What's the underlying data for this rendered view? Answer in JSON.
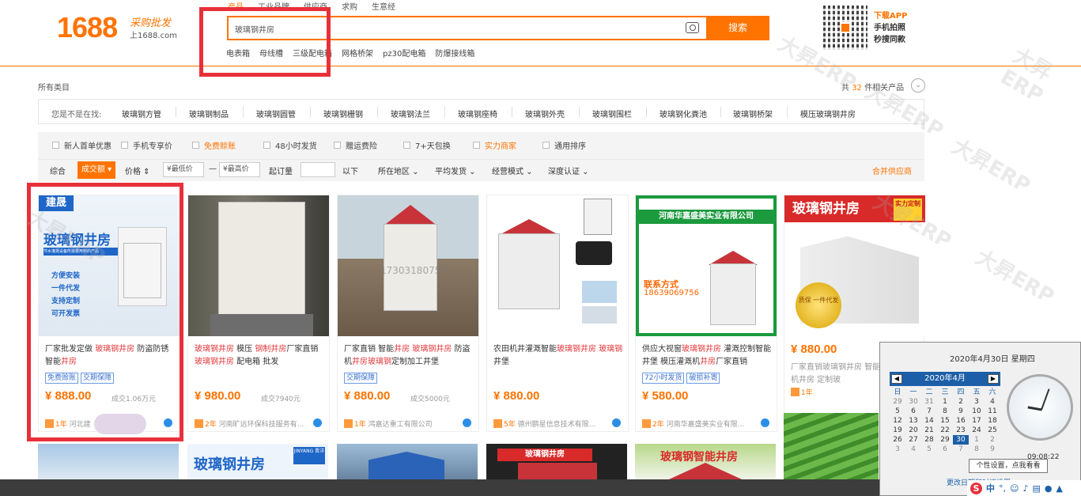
{
  "header": {
    "logo_number": "1688",
    "logo_cn": "采购批发",
    "logo_domain": "上1688.com",
    "tabs": [
      "产品",
      "工业品牌",
      "供应商",
      "求购",
      "生意经"
    ],
    "search_value": "玻璃钢井房",
    "search_button": "搜索",
    "hot_words": [
      "电表箱",
      "母线槽",
      "三级配电箱",
      "网格桥架",
      "pz30配电箱",
      "防爆接线箱"
    ],
    "app_line1": "下载APP",
    "app_line2": "手机拍照",
    "app_line3": "秒搜同款"
  },
  "crumb": "所有类目",
  "count": {
    "prefix": "共",
    "num": "32",
    "suffix": "件相关产品"
  },
  "maybe": {
    "label": "您是不是在找:",
    "items": [
      "玻璃钢方管",
      "玻璃钢制品",
      "玻璃钢圆管",
      "玻璃钢栅钢",
      "玻璃钢法兰",
      "玻璃钢座椅",
      "玻璃钢外壳",
      "玻璃钢围栏",
      "玻璃钢化粪池",
      "玻璃钢桥架",
      "模压玻璃钢井房"
    ]
  },
  "filters": {
    "checks": [
      "新人首单优惠",
      "手机专享价",
      "免费赊账",
      "48小时发货",
      "赠运费险",
      "7+天包换",
      "实力商家",
      "通用排序"
    ],
    "sort": {
      "overall": "综合",
      "volume": "成交额",
      "price": "价格",
      "min": "¥最低价",
      "dash": "—",
      "max": "¥最高价",
      "moq": "起订量",
      "below": "以下",
      "region": "所在地区",
      "ship": "平均发货",
      "mode": "经营模式",
      "depth": "深度认证",
      "merge": "合并供应商"
    }
  },
  "products": [
    {
      "title_pre": "厂家批发定做 ",
      "title_red": "玻璃钢井房",
      "title_post": " 防盗防锈智能",
      "title_red2": "井房",
      "tags": [
        "免费赊账",
        "交期保障"
      ],
      "price": "¥ 888.00",
      "deal": "成交1.06万元",
      "year": "1年",
      "seller": "河北建",
      "img_label": "玻璃钢井房",
      "img_brand": "建晟",
      "features": [
        "方便安装",
        "一件代发",
        "支持定制",
        "可开发票"
      ],
      "sub": "节水灌溉设备所需要用到的产品"
    },
    {
      "title_pre": "",
      "title_red": "玻璃钢井房",
      "title_post": " 模压 ",
      "title_red2": "钢制井房",
      "title_post2": "厂家直销 ",
      "title_red3": "玻璃钢井房",
      "title_post3": " 配电箱 批发",
      "tags": [],
      "price": "¥ 980.00",
      "deal": "成交7940元",
      "year": "2年",
      "seller": "河南旷远环保科技服务有..."
    },
    {
      "title_pre": "厂家直销 智能",
      "title_red": "井房",
      "title_post": " ",
      "title_red2": "玻璃钢井房",
      "title_post2": " 防盗机",
      "title_red3": "井房玻璃钢",
      "title_post3": "定制加工井堡",
      "tags": [
        "交期保障"
      ],
      "price": "¥ 880.00",
      "deal": "成交5000元",
      "year": "1年",
      "seller": "鸿嘉达重工有限公司",
      "img_wm": "17303180758"
    },
    {
      "title_pre": "农田机井灌溉智能",
      "title_red": "玻璃钢井房",
      "title_post": " ",
      "title_red2": "玻璃钢",
      "title_post2": "井堡",
      "tags": [],
      "price": "¥ 880.00",
      "deal": "",
      "year": "5年",
      "seller": "德州鹏星信息技术有限..."
    },
    {
      "title_pre": "供应大视窗",
      "title_red": "玻璃钢井房",
      "title_post": " 灌溉控制智能井堡 模压灌溉机",
      "title_red2": "井房",
      "title_post2": "厂家直销",
      "tags": [
        "72小时发货",
        "破损补寄"
      ],
      "price": "¥ 580.00",
      "deal": "",
      "year": "2年",
      "seller": "河南华嘉盛美实业有限...",
      "img_brand": "河南华嘉盛美实业有限公司",
      "img_contact": "联系方式",
      "img_phone": "18639069756"
    },
    {
      "title_pre": "厂家直销玻璃钢井房 智能井堡 防盗机井房 定制玻",
      "title_red": "",
      "title_post": "",
      "tags": [],
      "price": "¥ 880.00",
      "deal": "",
      "year": "1年",
      "seller": "",
      "img_label": "玻璃钢井房",
      "img_badge": "实力定制",
      "img_gold": "质保 一件代发"
    }
  ],
  "row2_labels": [
    "",
    "玻璃钢井房",
    "",
    "玻璃钢井房",
    "玻璃钢智能井房",
    ""
  ],
  "row2_brand": "JINYANG 晋洋",
  "calendar": {
    "date_text": "2020年4月30日 星期四",
    "month": "2020年4月",
    "weekdays": [
      "日",
      "一",
      "二",
      "三",
      "四",
      "五",
      "六"
    ],
    "weeks": [
      [
        "29",
        "30",
        "31",
        "1",
        "2",
        "3",
        "4"
      ],
      [
        "5",
        "6",
        "7",
        "8",
        "9",
        "10",
        "11"
      ],
      [
        "12",
        "13",
        "14",
        "15",
        "16",
        "17",
        "18"
      ],
      [
        "19",
        "20",
        "21",
        "22",
        "23",
        "24",
        "25"
      ],
      [
        "26",
        "27",
        "28",
        "29",
        "30",
        "1",
        "2"
      ],
      [
        "3",
        "4",
        "5",
        "6",
        "7",
        "8",
        "9"
      ]
    ],
    "selected": "30",
    "time": "09:08:22",
    "tooltip": "个性设置，点我看看",
    "link": "更改日期和时间设置..."
  },
  "ime": {
    "logo": "S",
    "lang": "中"
  },
  "watermark": "大昇ERP"
}
